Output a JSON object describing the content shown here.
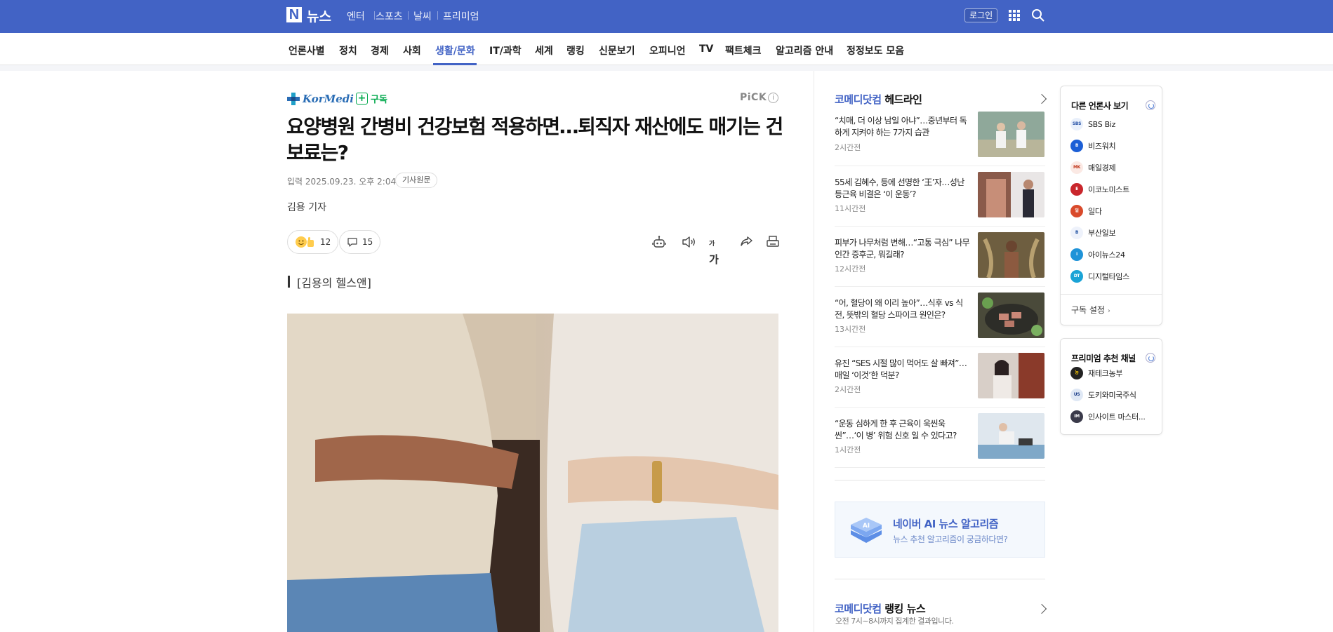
{
  "header": {
    "logo_letter": "N",
    "logo_text": "뉴스",
    "services": [
      "엔터",
      "스포츠",
      "날씨",
      "프리미엄"
    ],
    "login_label": "로그인"
  },
  "categories": [
    "언론사별",
    "정치",
    "경제",
    "사회",
    "생활/문화",
    "IT/과학",
    "세계",
    "랭킹",
    "신문보기",
    "오피니언",
    "TV",
    "팩트체크",
    "알고리즘 안내",
    "정정보도 모음"
  ],
  "active_category": "생활/문화",
  "article": {
    "press_name": "KorMedi",
    "subscribe_label": "구독",
    "pick_label": "PiCK",
    "headline": "요양병원 간병비 건강보험 적용하면…퇴직자 재산에도 매기는 건보료는?",
    "date_label": "입력",
    "date": "2025.09.23. 오후 2:04",
    "original_label": "기사원문",
    "reporter": "김용 기자",
    "reaction_count": "12",
    "comment_count": "15",
    "font_size_label": "가",
    "quote": "[김용의 헬스앤]"
  },
  "headlines": {
    "brand": "코메디닷컴",
    "title": "헤드라인",
    "items": [
      {
        "text": "“치매, 더 이상 남일 아냐”…중년부터 독하게 지켜야 하는 7가지 습관",
        "time": "2시간전"
      },
      {
        "text": "55세 김혜수, 등에 선명한 ‘王’자…성난 등근육 비결은 ‘이 운동’?",
        "time": "11시간전"
      },
      {
        "text": "피부가 나무처럼 변해…“고통 극심” 나무인간 증후군, 뭐길래?",
        "time": "12시간전"
      },
      {
        "text": "“어, 혈당이 왜 이리 높아”…식후 vs 식전, 뜻밖의 혈당 스파이크 원인은?",
        "time": "13시간전"
      },
      {
        "text": "유진 “SES 시절 많이 먹어도 살 빠져”…매일 ‘이것’한 덕분?",
        "time": "2시간전"
      },
      {
        "text": "“운동 심하게 한 후 근육이 욱씬욱씬”…‘이 병’ 위험 신호 일 수 있다고?",
        "time": "1시간전"
      }
    ]
  },
  "ai_banner": {
    "title": "네이버 AI 뉴스 알고리즘",
    "subtitle": "뉴스 추천 알고리즘이 궁금하다면?"
  },
  "ranking": {
    "brand": "코메디닷컴",
    "title": "랭킹 뉴스",
    "subtitle": "오전 7시~8시까지 집계한 결과입니다."
  },
  "other_press": {
    "title": "다른 언론사 보기",
    "items": [
      "SBS Biz",
      "비즈워치",
      "매일경제",
      "이코노미스트",
      "일다",
      "부산일보",
      "아이뉴스24",
      "디지털타임스"
    ],
    "footer": "구독 설정"
  },
  "premium": {
    "title": "프리미엄 추천 채널",
    "items": [
      "재테크농부",
      "도키와미국주식",
      "인사이트 마스터..."
    ]
  },
  "colors": {
    "brand_blue": "#4263c5",
    "subscribe_green": "#03a94d"
  }
}
